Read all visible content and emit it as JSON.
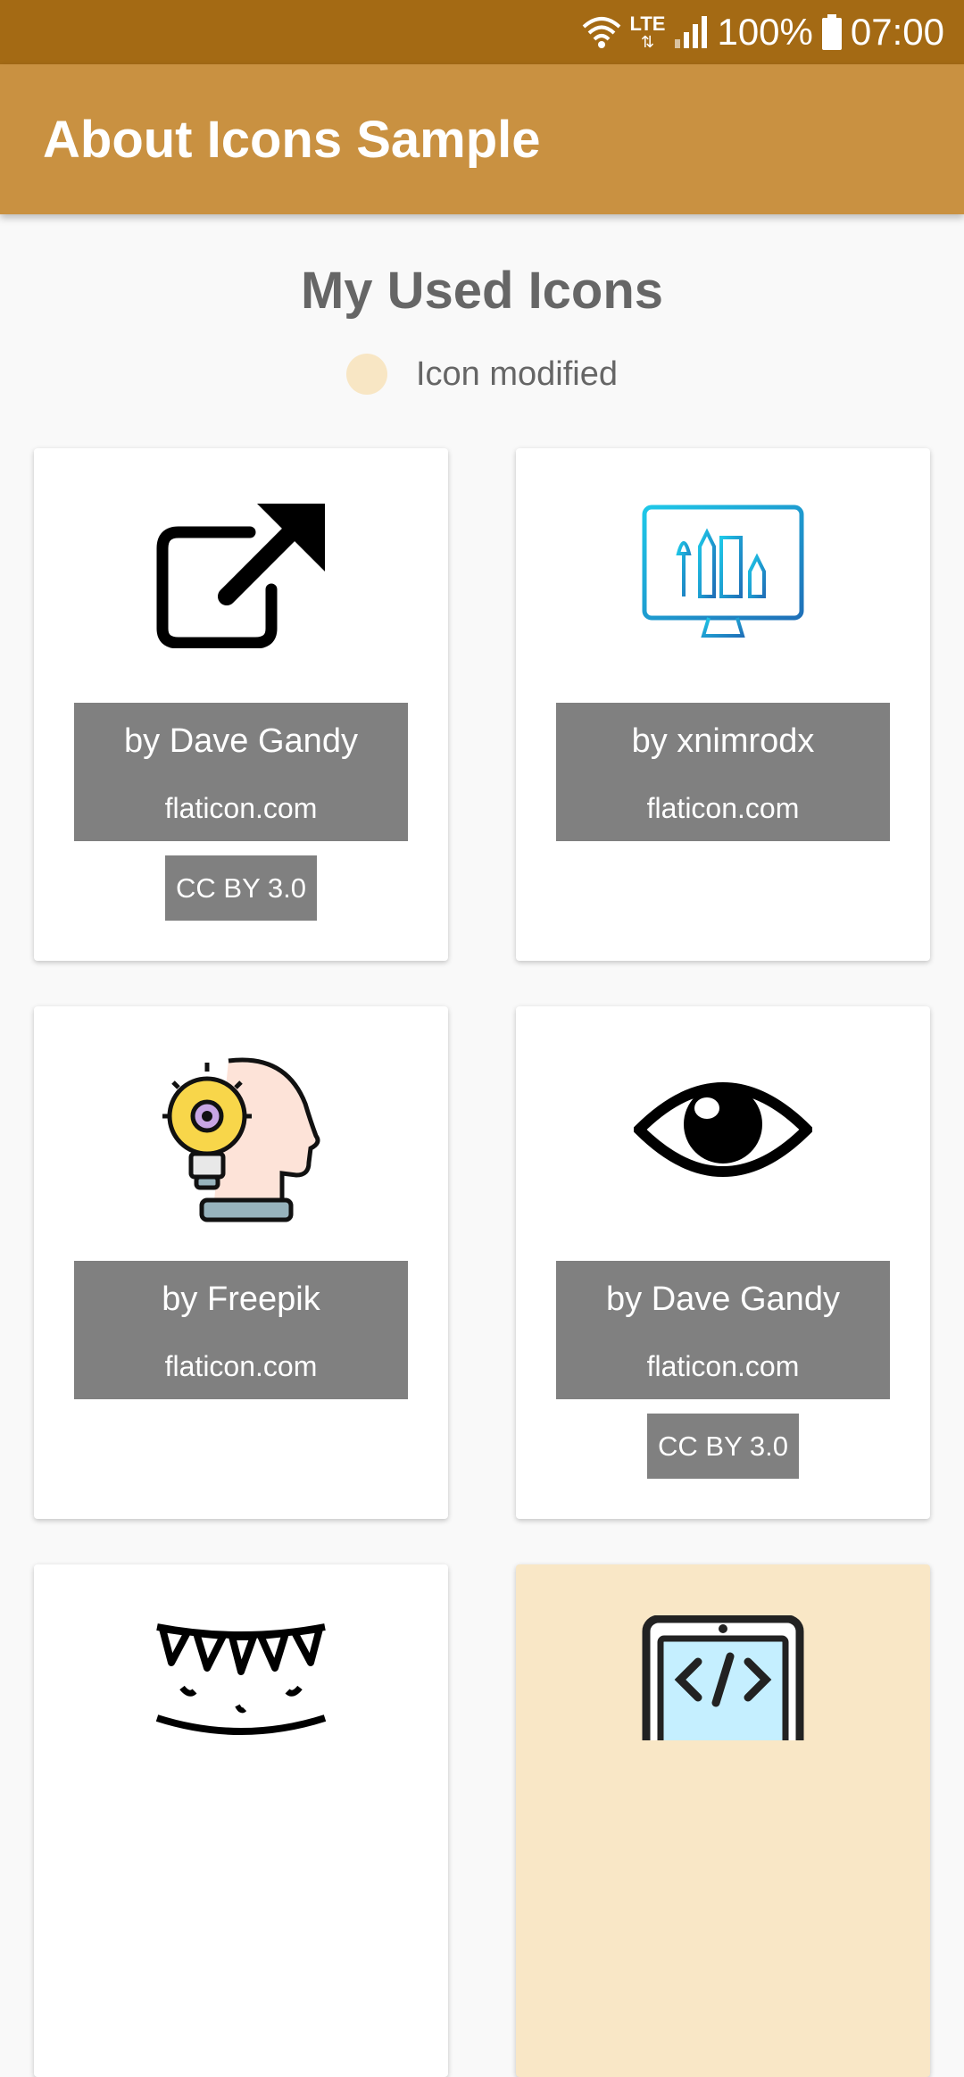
{
  "status_bar": {
    "network": "LTE",
    "battery": "100%",
    "time": "07:00"
  },
  "app_bar": {
    "title": "About Icons Sample"
  },
  "main": {
    "title": "My Used Icons",
    "legend_label": "Icon modified",
    "legend_color": "#f8e6c4",
    "cards": [
      {
        "icon": "external-link-icon",
        "author": "by Dave Gandy",
        "site": "flaticon.com",
        "license": "CC BY 3.0"
      },
      {
        "icon": "design-monitor-icon",
        "author": "by xnimrodx",
        "site": "flaticon.com",
        "license": ""
      },
      {
        "icon": "idea-head-icon",
        "author": "by Freepik",
        "site": "flaticon.com",
        "license": ""
      },
      {
        "icon": "eye-icon",
        "author": "by Dave Gandy",
        "site": "flaticon.com",
        "license": "CC BY 3.0"
      },
      {
        "icon": "party-bunting-icon",
        "author": "",
        "site": "",
        "license": ""
      },
      {
        "icon": "code-monitor-icon",
        "author": "",
        "site": "",
        "license": "",
        "modified": true
      }
    ]
  },
  "colors": {
    "status_bar": "#a46a14",
    "app_bar": "#c99141",
    "credit_box": "#808080",
    "modified_card": "#f9e7c6"
  }
}
